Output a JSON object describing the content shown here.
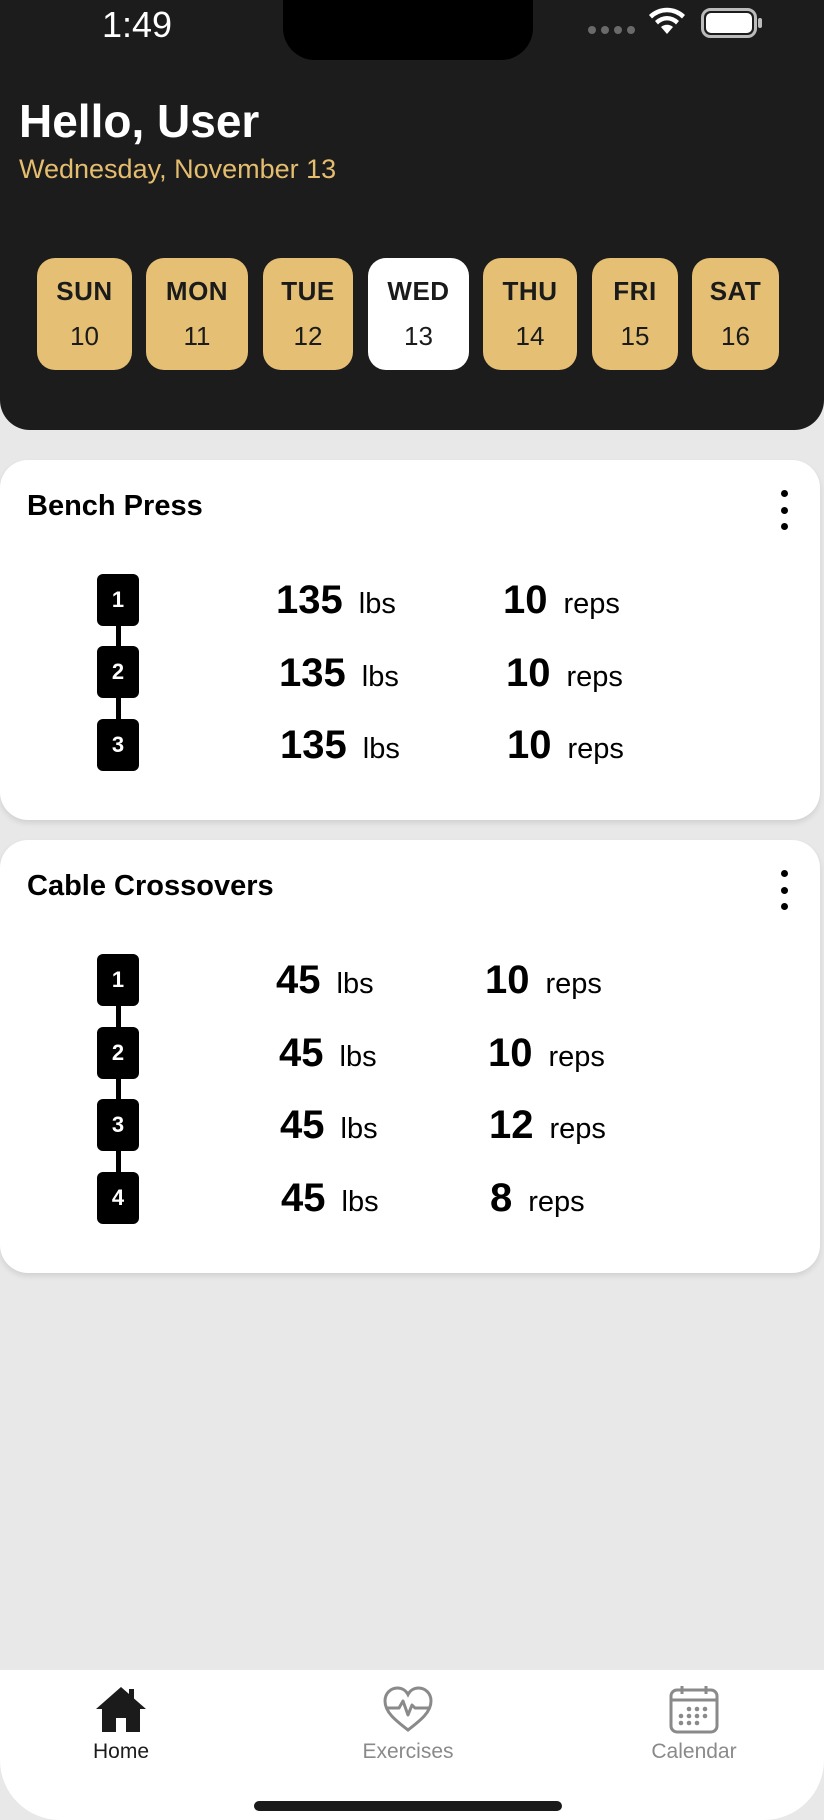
{
  "status_bar": {
    "time": "1:49"
  },
  "header": {
    "greeting": "Hello, User",
    "date": "Wednesday, November 13"
  },
  "week": [
    {
      "day": "SUN",
      "num": "10",
      "selected": false
    },
    {
      "day": "MON",
      "num": "11",
      "selected": false
    },
    {
      "day": "TUE",
      "num": "12",
      "selected": false
    },
    {
      "day": "WED",
      "num": "13",
      "selected": true
    },
    {
      "day": "THU",
      "num": "14",
      "selected": false
    },
    {
      "day": "FRI",
      "num": "15",
      "selected": false
    },
    {
      "day": "SAT",
      "num": "16",
      "selected": false
    }
  ],
  "exercises": [
    {
      "name": "Bench Press",
      "sets": [
        {
          "set": "1",
          "weight": "135",
          "weight_unit": "lbs",
          "reps": "10",
          "reps_unit": "reps"
        },
        {
          "set": "2",
          "weight": "135",
          "weight_unit": "lbs",
          "reps": "10",
          "reps_unit": "reps"
        },
        {
          "set": "3",
          "weight": "135",
          "weight_unit": "lbs",
          "reps": "10",
          "reps_unit": "reps"
        }
      ]
    },
    {
      "name": "Cable Crossovers",
      "sets": [
        {
          "set": "1",
          "weight": "45",
          "weight_unit": "lbs",
          "reps": "10",
          "reps_unit": "reps"
        },
        {
          "set": "2",
          "weight": "45",
          "weight_unit": "lbs",
          "reps": "10",
          "reps_unit": "reps"
        },
        {
          "set": "3",
          "weight": "45",
          "weight_unit": "lbs",
          "reps": "12",
          "reps_unit": "reps"
        },
        {
          "set": "4",
          "weight": "45",
          "weight_unit": "lbs",
          "reps": "8",
          "reps_unit": "reps"
        }
      ]
    }
  ],
  "tabs": [
    {
      "label": "Home",
      "icon": "home-icon",
      "active": true
    },
    {
      "label": "Exercises",
      "icon": "heart-pulse-icon",
      "active": false
    },
    {
      "label": "Calendar",
      "icon": "calendar-icon",
      "active": false
    }
  ],
  "colors": {
    "header_bg": "#1c1c1c",
    "accent_gold": "#e4bf74",
    "page_bg": "#e8e8e8"
  }
}
